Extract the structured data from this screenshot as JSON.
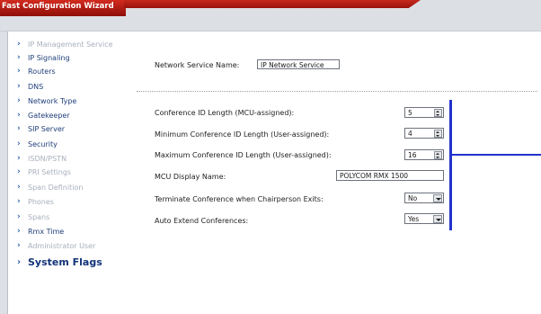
{
  "window": {
    "title": "Fast Configuration Wizard"
  },
  "sidebar": {
    "items": [
      {
        "label": "IP Management Service",
        "state": "disabled"
      },
      {
        "label": "IP Signaling",
        "state": "enabled"
      },
      {
        "label": "Routers",
        "state": "enabled"
      },
      {
        "label": "DNS",
        "state": "enabled"
      },
      {
        "label": "Network Type",
        "state": "enabled"
      },
      {
        "label": "Gatekeeper",
        "state": "enabled"
      },
      {
        "label": "SIP Server",
        "state": "enabled"
      },
      {
        "label": "Security",
        "state": "enabled"
      },
      {
        "label": "ISDN/PSTN",
        "state": "disabled"
      },
      {
        "label": "PRI Settings",
        "state": "disabled"
      },
      {
        "label": "Span Definition",
        "state": "disabled"
      },
      {
        "label": "Phones",
        "state": "disabled"
      },
      {
        "label": "Spans",
        "state": "disabled"
      },
      {
        "label": "Rmx Time",
        "state": "enabled"
      },
      {
        "label": "Administrator User",
        "state": "disabled"
      },
      {
        "label": "System Flags",
        "state": "current"
      }
    ]
  },
  "form": {
    "network_service_label": "Network Service Name:",
    "network_service_value": "IP Network Service",
    "fields": [
      {
        "label": "Conference ID Length (MCU-assigned):",
        "value": "5",
        "control": "spinner"
      },
      {
        "label": "Minimum Conference ID Length (User-assigned):",
        "value": "4",
        "control": "spinner"
      },
      {
        "label": "Maximum Conference ID Length (User-assigned):",
        "value": "16",
        "control": "spinner"
      },
      {
        "label": "MCU Display Name:",
        "value": "POLYCOM RMX 1500",
        "control": "text"
      },
      {
        "label": "Terminate Conference when Chairperson Exits:",
        "value": "No",
        "control": "select"
      },
      {
        "label": "Auto Extend Conferences:",
        "value": "Yes",
        "control": "select"
      }
    ]
  },
  "colors": {
    "title_bar": "#b51a12",
    "nav_enabled": "#1f3f7a",
    "nav_disabled": "#a8b0bc",
    "nav_chevron": "#2d5fa8",
    "callout_line": "#2233cc"
  }
}
